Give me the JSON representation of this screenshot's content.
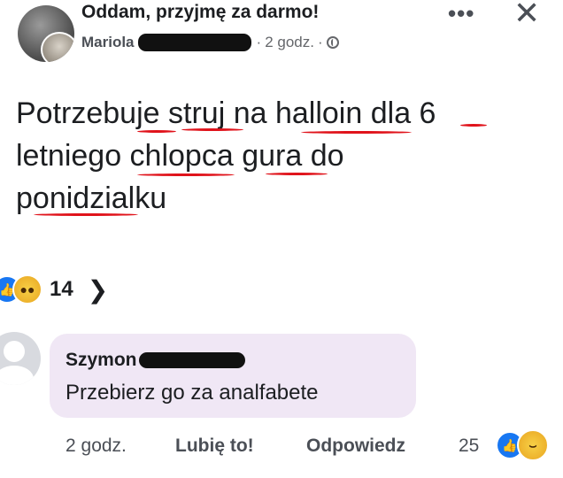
{
  "post": {
    "group_name": "Oddam, przyjmę za darmo!",
    "author": "Mariola",
    "time": "2 godz.",
    "separator": "·",
    "more_label": "•••",
    "close_label": "✕",
    "text_line1": [
      "Potrzebu",
      "je",
      " ",
      "struj",
      " na ",
      "halloin",
      " dla ",
      "6"
    ],
    "text_line2": [
      "letniego ",
      "chlopca",
      " ",
      "gura",
      " do"
    ],
    "text_line3": [
      "ponidzialku"
    ],
    "reactions": {
      "count": "14",
      "icons": [
        "like-icon",
        "wow-icon"
      ]
    }
  },
  "comment": {
    "author": "Szymon",
    "text": "Przebierz go za analfabete",
    "time": "2 godz.",
    "like_label": "Lubię to!",
    "reply_label": "Odpowiedz",
    "reaction_count": "25",
    "reaction_icons": [
      "like-icon",
      "haha-icon"
    ]
  },
  "colors": {
    "underline": "#e0131b",
    "comment_bubble": "#f0e7f5",
    "like_blue": "#1877f2"
  }
}
